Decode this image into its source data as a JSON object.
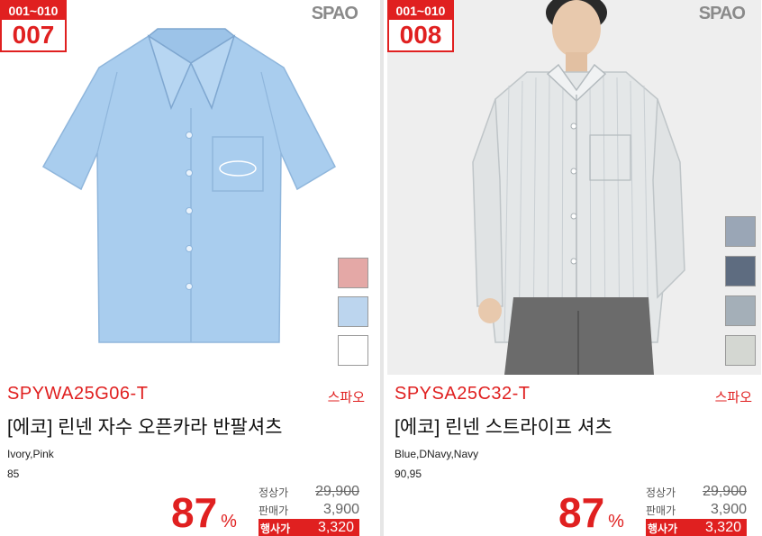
{
  "products": [
    {
      "badge_range": "001~010",
      "badge_number": "007",
      "logo": "SPAO",
      "code": "SPYWA25G06-T",
      "brand": "스파오",
      "name": "[에코] 린넨 자수 오픈카라 반팔셔츠",
      "colors": "Ivory,Pink",
      "sizes": "85",
      "discount": "87",
      "discount_unit": "%",
      "price_labels": {
        "regular": "정상가",
        "sale": "판매가",
        "event": "행사가"
      },
      "regular_price": "29,900",
      "sale_price": "3,900",
      "event_price": "3,320",
      "swatches": [
        "#e4a8a6",
        "#bcd5ee",
        "#ffffff"
      ],
      "garment_color": "#a9cdee"
    },
    {
      "badge_range": "001~010",
      "badge_number": "008",
      "logo": "SPAO",
      "code": "SPYSA25C32-T",
      "brand": "스파오",
      "name": "[에코] 린넨 스트라이프 셔츠",
      "colors": "Blue,DNavy,Navy",
      "sizes": "90,95",
      "discount": "87",
      "discount_unit": "%",
      "price_labels": {
        "regular": "정상가",
        "sale": "판매가",
        "event": "행사가"
      },
      "regular_price": "29,900",
      "sale_price": "3,900",
      "event_price": "3,320",
      "swatches": [
        "#9aa6b6",
        "#5e6c80",
        "#a4afb8",
        "#d4d7d2"
      ],
      "garment_color": "#e4e7e8"
    }
  ]
}
